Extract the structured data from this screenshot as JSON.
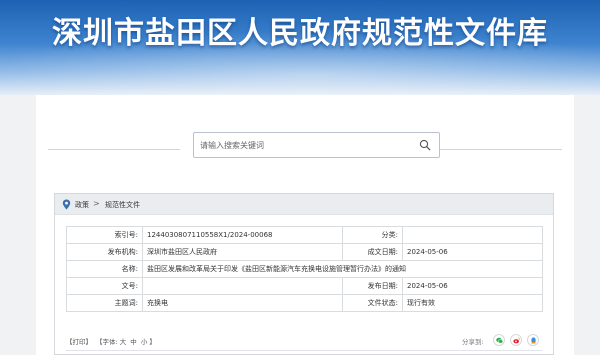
{
  "banner": {
    "title": "深圳市盐田区人民政府规范性文件库"
  },
  "search": {
    "placeholder": "请输入搜索关键词"
  },
  "breadcrumb": {
    "home": "政策",
    "separator": ">",
    "current": "规范性文件"
  },
  "meta": {
    "index_label": "索引号:",
    "index_value": "1244030807110558X1/2024-00068",
    "category_label": "分类:",
    "category_value": "",
    "publisher_label": "发布机构:",
    "publisher_value": "深圳市盐田区人民政府",
    "created_label": "成文日期:",
    "created_value": "2024-05-06",
    "name_label": "名称:",
    "name_value": "盐田区发展和改革局关于印发《盐田区新能源汽车充换电设施管理暂行办法》的通知",
    "docno_label": "文号:",
    "docno_value": "",
    "pubdate_label": "发布日期:",
    "pubdate_value": "2024-05-06",
    "subject_label": "主题词:",
    "subject_value": "充换电",
    "status_label": "文件状态:",
    "status_value": "现行有效"
  },
  "tools": {
    "print": "【打印】",
    "font_prefix": "【字体:",
    "font_large": "大",
    "font_medium": "中",
    "font_small": "小",
    "font_suffix": "】",
    "share_label": "分享到:"
  },
  "colors": {
    "banner_top": "#1e63b3",
    "share_wechat": "#2eb24b",
    "share_weibo": "#e6162d",
    "share_qq": "#3a8ee6"
  },
  "icons": [
    "search-icon",
    "location-pin-icon",
    "wechat-icon",
    "weibo-icon",
    "qq-icon"
  ]
}
